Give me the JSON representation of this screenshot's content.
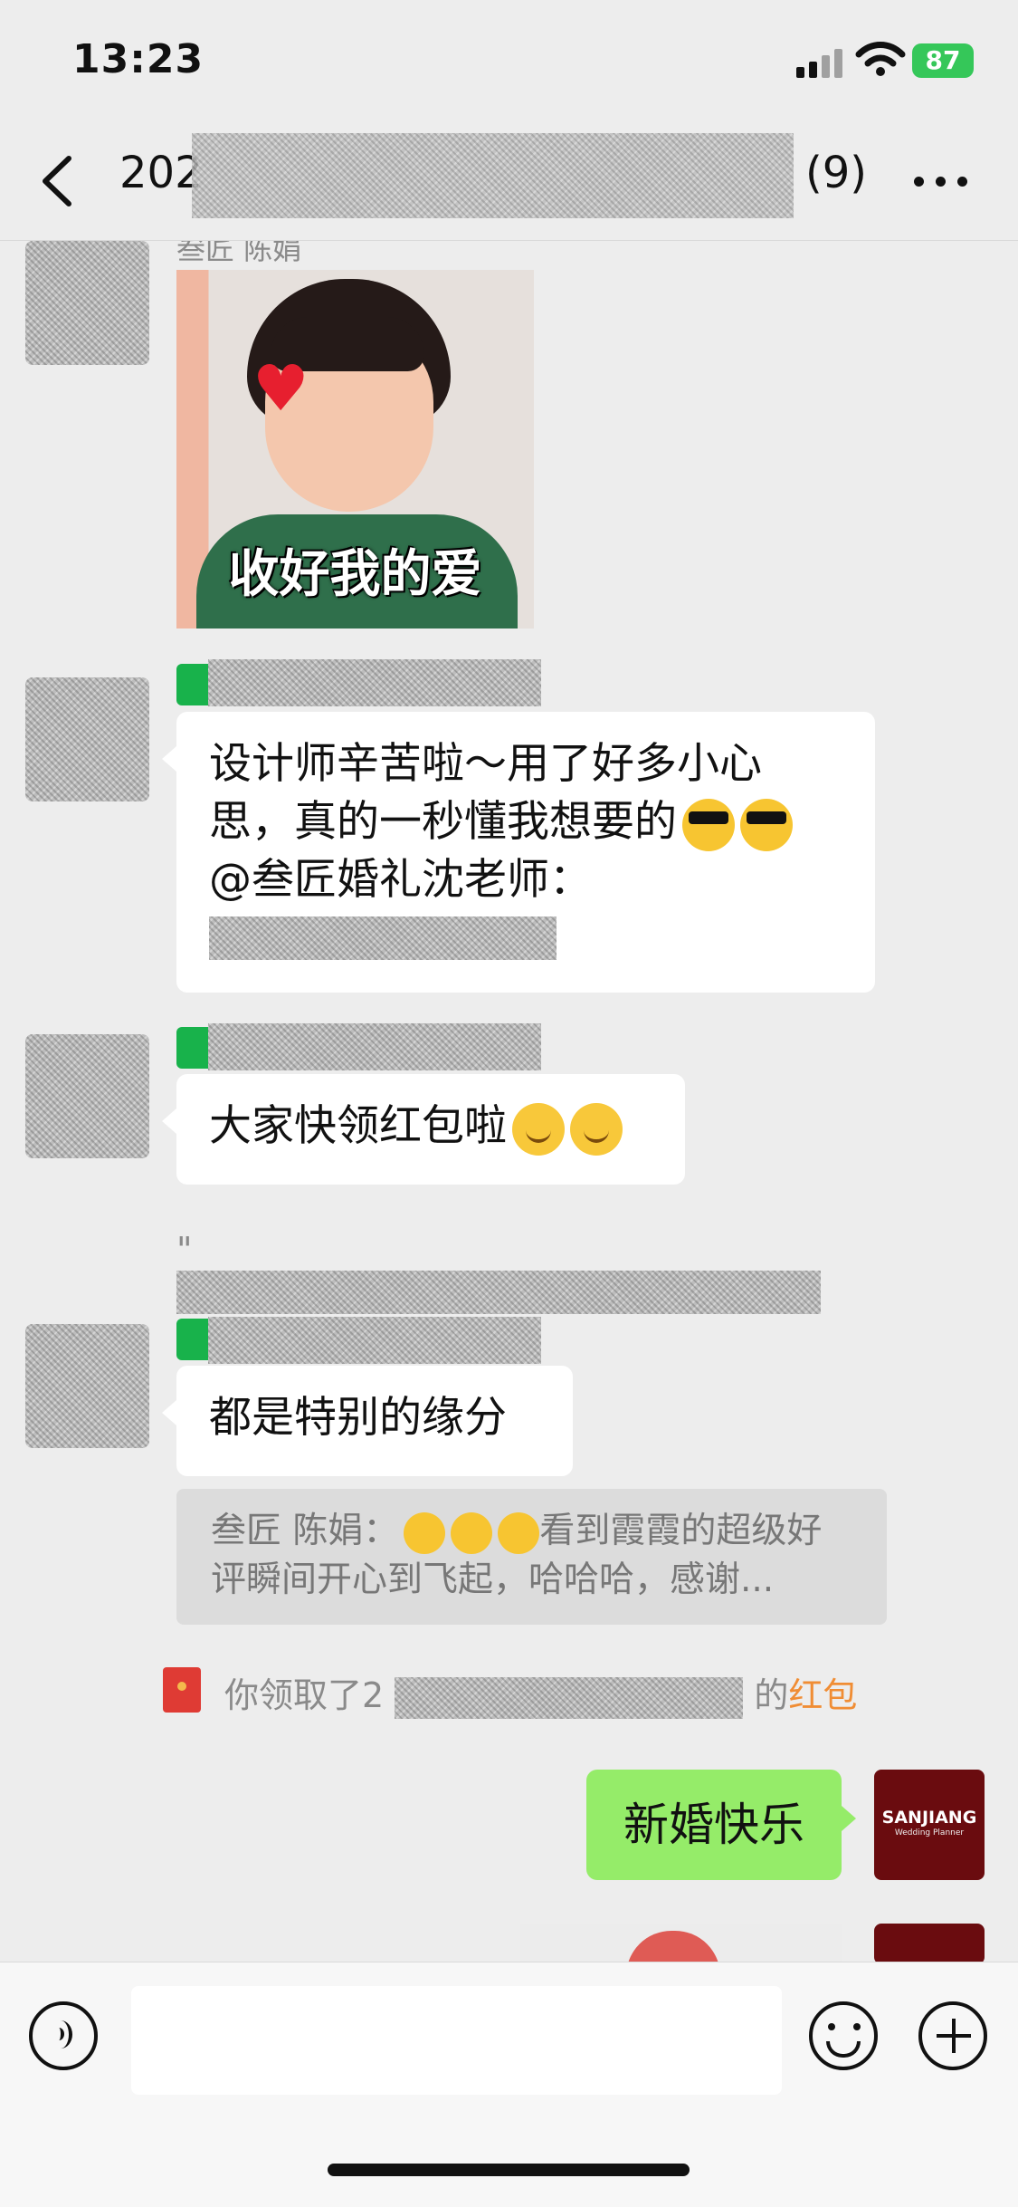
{
  "status_bar": {
    "time": "13:23",
    "battery": "87"
  },
  "header": {
    "title_visible_prefix": "202",
    "member_count": "(9)"
  },
  "chat": {
    "sticker_sender": "叁匠 陈娟",
    "sticker_caption": "收好我的爱",
    "message_1": {
      "line_1": "设计师辛苦啦～用了好多小心",
      "line_2": "思，真的一秒懂我想要的",
      "line_3": "@叁匠婚礼沈老师："
    },
    "message_2": "大家快领红包啦",
    "quote_mark": "\"",
    "message_3": "都是特别的缘分",
    "quoted_message": {
      "line_1_prefix": "叁匠 陈娟：",
      "line_1_text": "看到霞霞的超级好",
      "line_2": "评瞬间开心到飞起，哈哈哈，感谢..."
    },
    "red_packet_notice": {
      "prefix": "你领取了2",
      "suffix": "的",
      "link": "红包"
    },
    "own_message": "新婚快乐",
    "brand_avatar": {
      "name": "SANJIANG",
      "subtitle": "Wedding Planner"
    }
  },
  "composer": {
    "placeholder": ""
  },
  "icons": [
    "back-icon",
    "more-icon",
    "voice-icon",
    "emoji-icon",
    "plus-icon",
    "red-packet-icon"
  ],
  "colors": {
    "background": "#ededed",
    "wechat_green": "#95ec69",
    "red_packet_accent": "#f08d34",
    "battery": "#35c759"
  }
}
